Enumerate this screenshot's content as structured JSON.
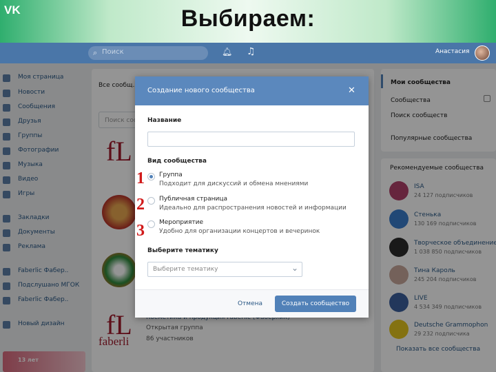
{
  "slide": {
    "title": "Выбираем:"
  },
  "header": {
    "search_placeholder": "Поиск",
    "user_name": "Анастасия"
  },
  "left_nav": {
    "items": [
      "Моя страница",
      "Новости",
      "Сообщения",
      "Друзья",
      "Группы",
      "Фотографии",
      "Музыка",
      "Видео",
      "Игры",
      "Закладки",
      "Документы",
      "Реклама",
      "Faberlic Фабер..",
      "Подслушано МГОК",
      "Faberlic Фабер..",
      "Новый дизайн"
    ],
    "promo_text": "13 лет"
  },
  "groups": {
    "tab_all": "Все сообщ...",
    "search_placeholder": "Поиск сооб...",
    "last_group": {
      "title": "Косметика и продукция Faberlic (Фаберлик)",
      "type": "Открытая группа",
      "members": "86 участников"
    }
  },
  "right_menu": {
    "my_communities": "Мои сообщества",
    "manage": "Сообщества",
    "find": "Поиск сообществ",
    "popular": "Популярные сообщества"
  },
  "recommended": {
    "title": "Рекомендуемые сообщества",
    "items": [
      {
        "name": "ISA",
        "count": "24 127 подписчиков",
        "color": "#b0406a"
      },
      {
        "name": "Стенька",
        "count": "130 169 подписчиков",
        "color": "#3a7dcc"
      },
      {
        "name": "Творческое объединение",
        "count": "1 038 850 подписчиков",
        "color": "#2c2c2c"
      },
      {
        "name": "Тина Кароль",
        "count": "245 204 подписчиков",
        "color": "#c9a89b"
      },
      {
        "name": "LIVE",
        "count": "4 534 349 подписчиков",
        "color": "#3b5f9e"
      },
      {
        "name": "Deutsche Grammophon",
        "count": "29 232 подписчика",
        "color": "#e3c41e"
      }
    ],
    "show_all": "Показать все сообщества"
  },
  "dialog": {
    "title": "Создание нового сообщества",
    "name_label": "Название",
    "name_value": "",
    "type_label": "Вид сообщества",
    "options": [
      {
        "title": "Группа",
        "desc": "Подходит для дискуссий и обмена мнениями",
        "checked": true
      },
      {
        "title": "Публичная страница",
        "desc": "Идеально для распространения новостей и информации",
        "checked": false
      },
      {
        "title": "Мероприятие",
        "desc": "Удобно для организации концертов и вечеринок",
        "checked": false
      }
    ],
    "topic_label": "Выберите тематику",
    "topic_value": "Выберите тематику",
    "cancel": "Отмена",
    "create": "Создать сообщество"
  },
  "annotations": [
    "1",
    "2",
    "3"
  ],
  "icons": {
    "logo": "vk-logo",
    "search": "search-icon",
    "bell": "bell-icon",
    "music": "music-icon",
    "close": "close-icon",
    "chevron": "chevron-down-icon"
  },
  "colors": {
    "vk_blue": "#4a76a8",
    "dialog_header": "#5b88bd",
    "button": "#5181b8",
    "annotation": "#d11a1a",
    "title_green": "#2fae6e"
  }
}
